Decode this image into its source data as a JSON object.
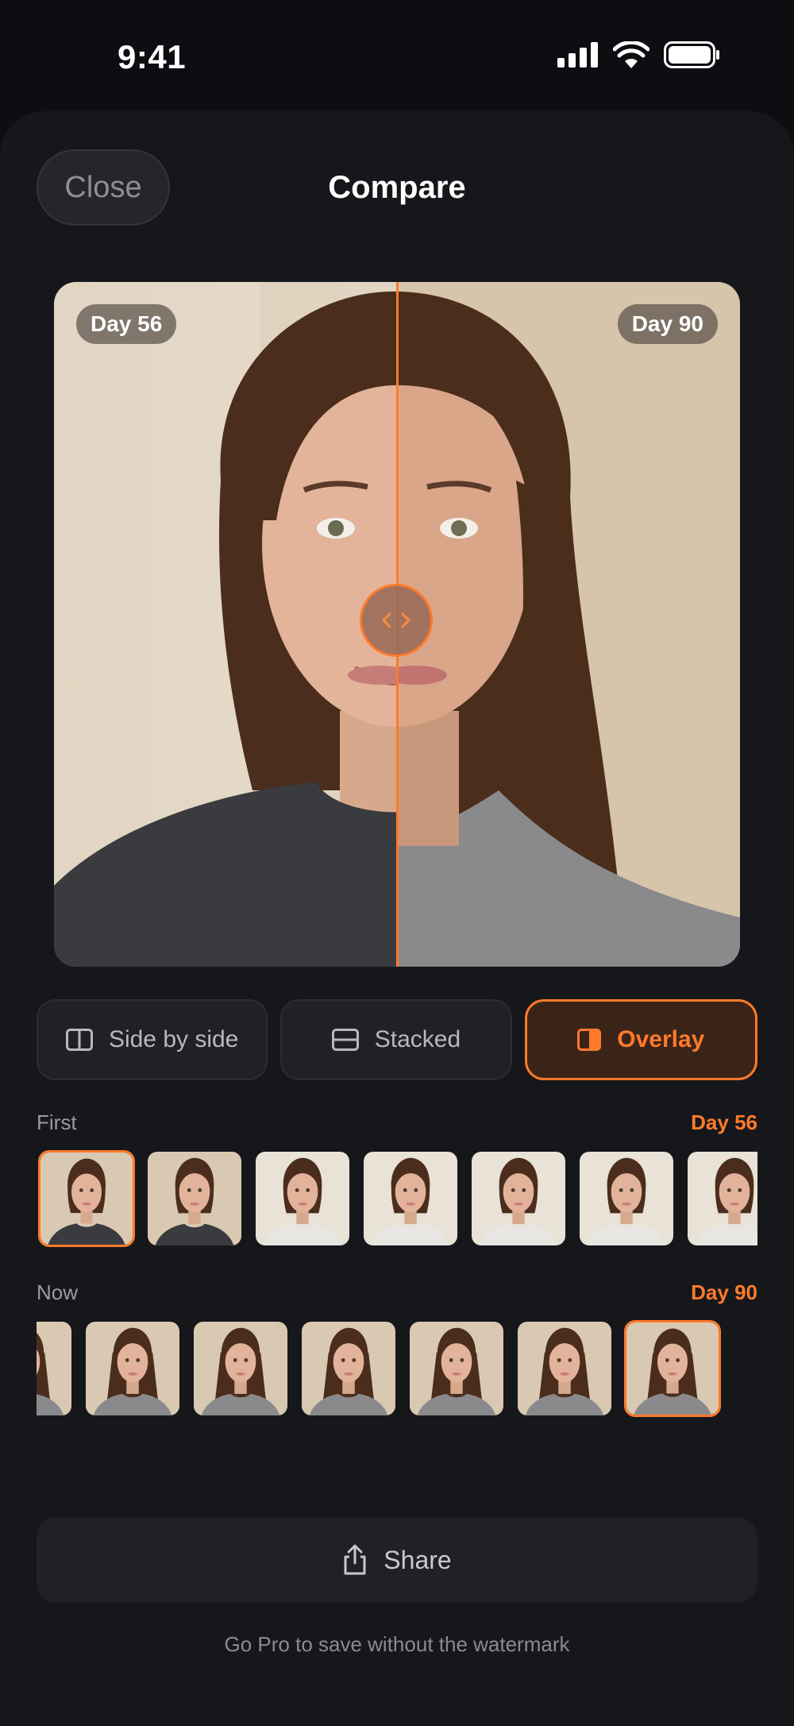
{
  "status_bar": {
    "time": "9:41"
  },
  "header": {
    "close_label": "Close",
    "title": "Compare"
  },
  "compare": {
    "left_label": "Day 56",
    "right_label": "Day 90",
    "split_fraction": 0.5
  },
  "modes": [
    {
      "label": "Side by side",
      "icon": "side-by-side-icon",
      "active": false
    },
    {
      "label": "Stacked",
      "icon": "stacked-icon",
      "active": false
    },
    {
      "label": "Overlay",
      "icon": "overlay-icon",
      "active": true
    }
  ],
  "first_row": {
    "label": "First",
    "selected_day": "Day 56",
    "thumb_count": 7,
    "selected_index": 0
  },
  "now_row": {
    "label": "Now",
    "selected_day": "Day 90",
    "thumb_count": 7,
    "selected_index": 6
  },
  "share": {
    "label": "Share",
    "icon": "share-icon"
  },
  "pro_note": "Go Pro to save without the watermark",
  "colors": {
    "accent": "#ff7a2a",
    "background": "#0d0e12",
    "sheet": "#16171b"
  }
}
